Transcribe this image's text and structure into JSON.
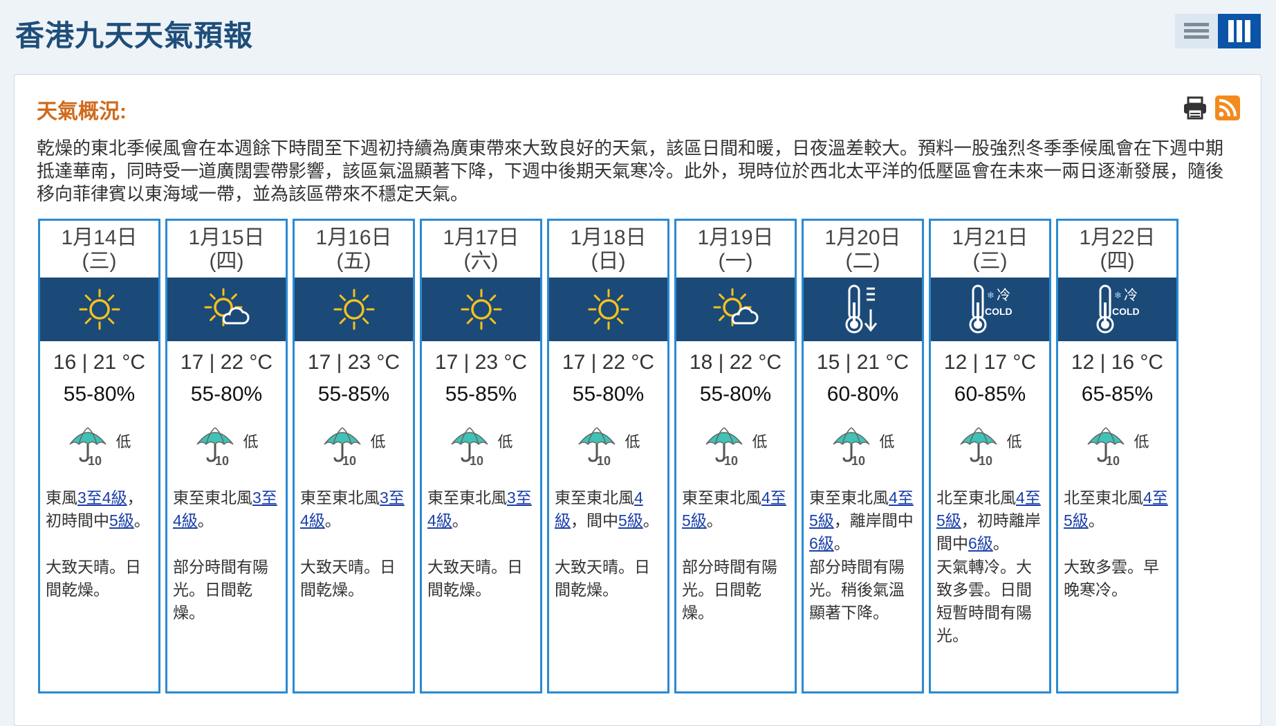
{
  "page": {
    "title": "香港九天天氣預報"
  },
  "colors": {
    "accent": "#d06a1c",
    "title": "#1f4e7a",
    "icon_band": "#1c4a78",
    "card_border": "#2a8ad2",
    "link": "#1a3faa"
  },
  "view_toggle": {
    "list_icon": "list-view-icon",
    "grid_icon": "grid-view-icon",
    "active": "grid"
  },
  "section": {
    "title": "天氣概況:",
    "print_icon": "print-icon",
    "rss_icon": "rss-icon",
    "synopsis": "乾燥的東北季候風會在本週餘下時間至下週初持續為廣東帶來大致良好的天氣，該區日間和暖，日夜溫差較大。預料一股強烈冬季季候風會在下週中期抵達華南，同時受一道廣闊雲帶影響，該區氣溫顯著下降，下週中後期天氣寒冷。此外，現時位於西北太平洋的低壓區會在未來一兩日逐漸發展，隨後移向菲律賓以東海域一帶，並為該區帶來不穩定天氣。"
  },
  "days": [
    {
      "date": "1月14日",
      "weekday": "(三)",
      "icon": "sunny",
      "temp": "16 | 21 °C",
      "rh": "55-80%",
      "psr": "低",
      "wind": [
        {
          "t": "東風"
        },
        {
          "t": "3至4級",
          "link": true
        },
        {
          "t": "，初時間中"
        },
        {
          "t": "5級",
          "link": true
        },
        {
          "t": "。"
        }
      ],
      "desc": "大致天晴。日間乾燥。"
    },
    {
      "date": "1月15日",
      "weekday": "(四)",
      "icon": "sunny-periods",
      "temp": "17 | 22 °C",
      "rh": "55-80%",
      "psr": "低",
      "wind": [
        {
          "t": "東至東北風"
        },
        {
          "t": "3至4級",
          "link": true
        },
        {
          "t": "。"
        }
      ],
      "desc": "部分時間有陽光。日間乾燥。"
    },
    {
      "date": "1月16日",
      "weekday": "(五)",
      "icon": "sunny",
      "temp": "17 | 23 °C",
      "rh": "55-85%",
      "psr": "低",
      "wind": [
        {
          "t": "東至東北風"
        },
        {
          "t": "3至4級",
          "link": true
        },
        {
          "t": "。"
        }
      ],
      "desc": "大致天晴。日間乾燥。"
    },
    {
      "date": "1月17日",
      "weekday": "(六)",
      "icon": "sunny",
      "temp": "17 | 23 °C",
      "rh": "55-85%",
      "psr": "低",
      "wind": [
        {
          "t": "東至東北風"
        },
        {
          "t": "3至4級",
          "link": true
        },
        {
          "t": "。"
        }
      ],
      "desc": "大致天晴。日間乾燥。"
    },
    {
      "date": "1月18日",
      "weekday": "(日)",
      "icon": "sunny",
      "temp": "17 | 22 °C",
      "rh": "55-80%",
      "psr": "低",
      "wind": [
        {
          "t": "東至東北風"
        },
        {
          "t": "4級",
          "link": true
        },
        {
          "t": "，間中"
        },
        {
          "t": "5級",
          "link": true
        },
        {
          "t": "。"
        }
      ],
      "desc": "大致天晴。日間乾燥。"
    },
    {
      "date": "1月19日",
      "weekday": "(一)",
      "icon": "sunny-periods",
      "temp": "18 | 22 °C",
      "rh": "55-80%",
      "psr": "低",
      "wind": [
        {
          "t": "東至東北風"
        },
        {
          "t": "4至5級",
          "link": true
        },
        {
          "t": "。"
        }
      ],
      "desc": "部分時間有陽光。日間乾燥。"
    },
    {
      "date": "1月20日",
      "weekday": "(二)",
      "icon": "temp-drop",
      "temp": "15 | 21 °C",
      "rh": "60-80%",
      "psr": "低",
      "wind": [
        {
          "t": "東至東北風"
        },
        {
          "t": "4至5級",
          "link": true
        },
        {
          "t": "，離岸間中"
        },
        {
          "t": "6級",
          "link": true
        },
        {
          "t": "。"
        }
      ],
      "desc": "部分時間有陽光。稍後氣溫顯著下降。"
    },
    {
      "date": "1月21日",
      "weekday": "(三)",
      "icon": "cold",
      "temp": "12 | 17 °C",
      "rh": "60-85%",
      "psr": "低",
      "wind": [
        {
          "t": "北至東北風"
        },
        {
          "t": "4至5級",
          "link": true
        },
        {
          "t": "，初時離岸間中"
        },
        {
          "t": "6級",
          "link": true
        },
        {
          "t": "。"
        }
      ],
      "desc": "天氣轉冷。大致多雲。日間短暫時間有陽光。"
    },
    {
      "date": "1月22日",
      "weekday": "(四)",
      "icon": "cold",
      "temp": "12 | 16 °C",
      "rh": "65-85%",
      "psr": "低",
      "wind": [
        {
          "t": "北至東北風"
        },
        {
          "t": "4至5級",
          "link": true
        },
        {
          "t": "。"
        }
      ],
      "desc": "大致多雲。早晚寒冷。"
    }
  ],
  "icon_text": {
    "cold_cn": "冷",
    "cold_en": "COLD",
    "psr_num": "10"
  }
}
